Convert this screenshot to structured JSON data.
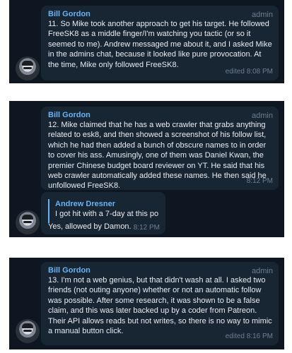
{
  "messages": [
    {
      "sender": "Bill Gordon",
      "role": "admin",
      "text": "11. So Mike took another approach to get his target. He followed FreeSK8 as a middle finger/I'm watching you tactic (or so it seemed to me). Andrew messaged me about it, and I asked Mike in the admins chat, because it looked like pure provocation. At the time, Mike only followed FreeSK8.",
      "time": "edited 8:08 PM"
    },
    {
      "sender": "Bill Gordon",
      "role": "admin",
      "text": "12. Mike claimed that he has a web crawler that grabs anything related to esk8, and then showed a screenshot of his follow list, which he had then added a bunch of obscure names to in order to cover his ass. Amusingly, one of them was Daniel Kwan, the premier Chinese budget board reviewer on YT. He said that his web crawler automatically added these names. He then said he unfollowed FreeSK8.",
      "time": "8:12 PM"
    },
    {
      "reply_to": {
        "sender": "Andrew Dresner",
        "text": "I got hit with a 7-day at this po..."
      },
      "text": "Yes, allowed by Damon.",
      "time": "8:12 PM"
    },
    {
      "sender": "Bill Gordon",
      "role": "admin",
      "text": "13. I'm not a web genius, but that didn't wash at all. I asked two friends (not outing anyone) whether or not an automatic follow was possible. After some research, it was shown to be a false claim, and this was later backed up by a coder from Patreon. Their API allows reads but not writes, so there is no way to mimic a manual button click.",
      "time": "edited 8:16 PM"
    }
  ]
}
